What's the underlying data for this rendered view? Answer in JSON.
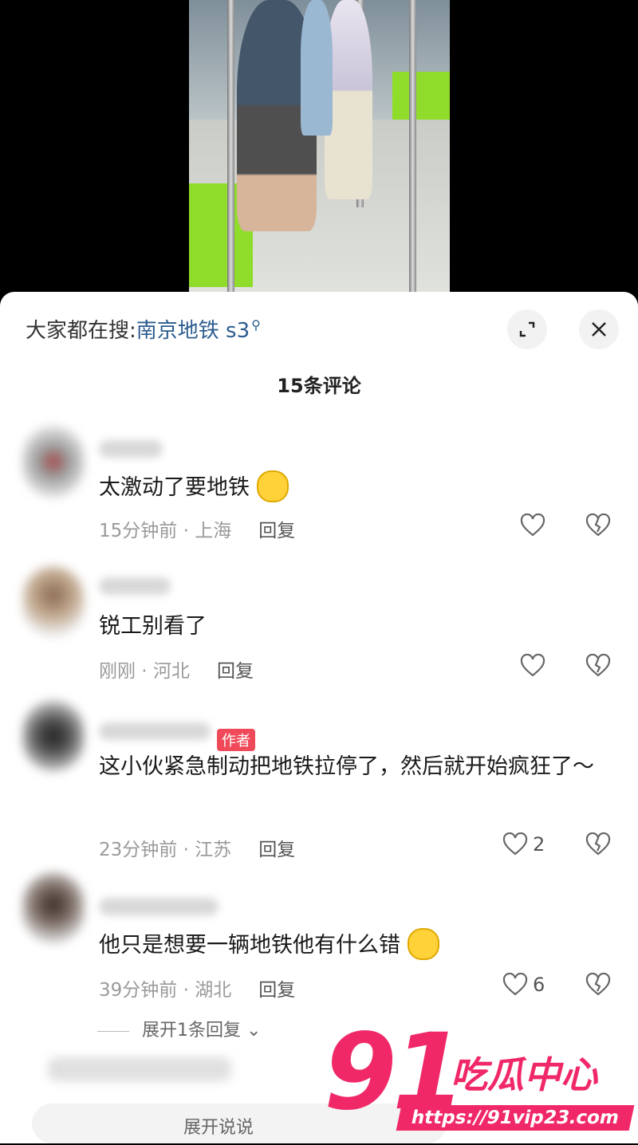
{
  "search": {
    "prefix": "大家都在搜:",
    "keyword": "南京地铁 s3",
    "icon": "search-icon"
  },
  "comment_count": "15条评论",
  "comments": [
    {
      "text": "太激动了要地铁",
      "emoji": "smiling-face",
      "time": "15分钟前",
      "location": "上海",
      "reply": "回复",
      "likes": "",
      "author": false
    },
    {
      "text": "锐工别看了",
      "emoji": "",
      "time": "刚刚",
      "location": "河北",
      "reply": "回复",
      "likes": "",
      "author": false
    },
    {
      "text": "这小伙紧急制动把地铁拉停了，然后就开始疯狂了～",
      "emoji": "",
      "time": "23分钟前",
      "location": "江苏",
      "reply": "回复",
      "likes": "2",
      "author": true,
      "author_label": "作者"
    },
    {
      "text": "他只是想要一辆地铁他有什么错",
      "emoji": "crying-face",
      "time": "39分钟前",
      "location": "湖北",
      "reply": "回复",
      "likes": "6",
      "author": false
    }
  ],
  "expand_replies": "展开1条回复",
  "bottom": {
    "input_hint": "展开说说"
  },
  "watermark": {
    "number": "91",
    "name": "吃瓜中心",
    "url": "https://91vip23.com"
  },
  "colors": {
    "accent": "#f02868",
    "search_keyword": "#2b5d8f",
    "author_tag": "#f04a5a"
  }
}
